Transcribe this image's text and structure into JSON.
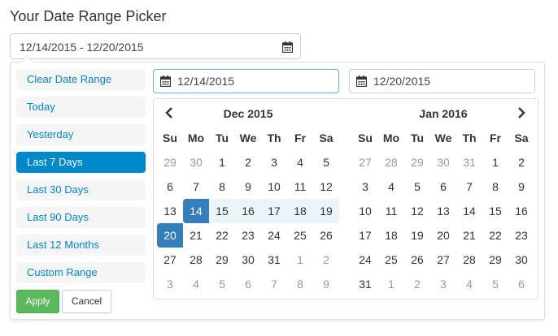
{
  "title": "Your Date Range Picker",
  "main_input": {
    "value": "12/14/2015 - 12/20/2015",
    "icon": "calendar-icon"
  },
  "ranges": [
    {
      "label": "Clear Date Range",
      "active": false
    },
    {
      "label": "Today",
      "active": false
    },
    {
      "label": "Yesterday",
      "active": false
    },
    {
      "label": "Last 7 Days",
      "active": true
    },
    {
      "label": "Last 30 Days",
      "active": false
    },
    {
      "label": "Last 90 Days",
      "active": false
    },
    {
      "label": "Last 12 Months",
      "active": false
    },
    {
      "label": "Custom Range",
      "active": false
    }
  ],
  "buttons": {
    "apply": "Apply",
    "cancel": "Cancel"
  },
  "start_input": {
    "value": "12/14/2015"
  },
  "end_input": {
    "value": "12/20/2015"
  },
  "calendars": [
    {
      "month": "Dec 2015",
      "days_of_week": [
        "Su",
        "Mo",
        "Tu",
        "We",
        "Th",
        "Fr",
        "Sa"
      ],
      "weeks": [
        [
          "29",
          "30",
          "1",
          "2",
          "3",
          "4",
          "5"
        ],
        [
          "6",
          "7",
          "8",
          "9",
          "10",
          "11",
          "12"
        ],
        [
          "13",
          "14",
          "15",
          "16",
          "17",
          "18",
          "19"
        ],
        [
          "20",
          "21",
          "22",
          "23",
          "24",
          "25",
          "26"
        ],
        [
          "27",
          "28",
          "29",
          "30",
          "31",
          "1",
          "2"
        ],
        [
          "3",
          "4",
          "5",
          "6",
          "7",
          "8",
          "9"
        ]
      ],
      "off": [
        [
          0,
          0
        ],
        [
          0,
          1
        ],
        [
          4,
          5
        ],
        [
          4,
          6
        ],
        [
          5,
          0
        ],
        [
          5,
          1
        ],
        [
          5,
          2
        ],
        [
          5,
          3
        ],
        [
          5,
          4
        ],
        [
          5,
          5
        ],
        [
          5,
          6
        ]
      ],
      "selected": [
        [
          2,
          1
        ],
        [
          3,
          0
        ]
      ],
      "in_range": [
        [
          2,
          2
        ],
        [
          2,
          3
        ],
        [
          2,
          4
        ],
        [
          2,
          5
        ],
        [
          2,
          6
        ]
      ]
    },
    {
      "month": "Jan 2016",
      "days_of_week": [
        "Su",
        "Mo",
        "Tu",
        "We",
        "Th",
        "Fr",
        "Sa"
      ],
      "weeks": [
        [
          "27",
          "28",
          "29",
          "30",
          "31",
          "1",
          "2"
        ],
        [
          "3",
          "4",
          "5",
          "6",
          "7",
          "8",
          "9"
        ],
        [
          "10",
          "11",
          "12",
          "13",
          "14",
          "15",
          "16"
        ],
        [
          "17",
          "18",
          "19",
          "20",
          "21",
          "22",
          "23"
        ],
        [
          "24",
          "25",
          "26",
          "27",
          "28",
          "29",
          "30"
        ],
        [
          "31",
          "1",
          "2",
          "3",
          "4",
          "5",
          "6"
        ]
      ],
      "off": [
        [
          0,
          0
        ],
        [
          0,
          1
        ],
        [
          0,
          2
        ],
        [
          0,
          3
        ],
        [
          0,
          4
        ],
        [
          5,
          1
        ],
        [
          5,
          2
        ],
        [
          5,
          3
        ],
        [
          5,
          4
        ],
        [
          5,
          5
        ],
        [
          5,
          6
        ]
      ],
      "selected": [],
      "in_range": []
    }
  ],
  "colors": {
    "accent": "#0088cc",
    "selected": "#357ebd",
    "range": "#ebf4f8",
    "apply": "#5cb85c"
  }
}
